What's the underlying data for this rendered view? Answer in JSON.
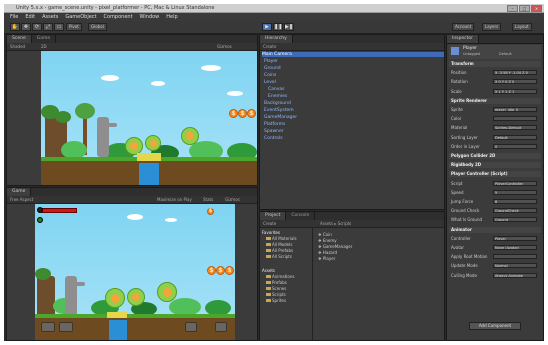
{
  "window": {
    "title": "Unity 5.x.x - game_scene.unity - pixel_platformer - PC, Mac & Linux Standalone",
    "min_icon": "minimize-icon",
    "max_icon": "maximize-icon",
    "close_icon": "close-icon"
  },
  "menu": [
    "File",
    "Edit",
    "Assets",
    "GameObject",
    "Component",
    "Window",
    "Help"
  ],
  "toolbar": {
    "tools": [
      "✋",
      "✥",
      "⟳",
      "⤢",
      "▭"
    ],
    "pivot": "Pivot",
    "global": "Global",
    "play": "▶",
    "pause": "❚❚",
    "step": "▶❚",
    "account": "Account",
    "layers": "Layers",
    "layout": "Layout"
  },
  "scene_panel": {
    "tabs": [
      "Scene",
      "Game"
    ],
    "subbar": [
      "Shaded",
      "2D",
      "Gizmos"
    ]
  },
  "game_panel": {
    "tabs": [
      "Game"
    ],
    "subbar": [
      "Free Aspect",
      "Maximize on Play",
      "Stats",
      "Gizmos"
    ]
  },
  "hierarchy": {
    "tab": "Hierarchy",
    "create": "Create",
    "items": [
      "Main Camera",
      "Player",
      "Ground",
      "Coins",
      "Level",
      "Canvas",
      "Enemies",
      "Background",
      "EventSystem",
      "GameManager",
      "Platforms",
      "Spawner",
      "Controls"
    ]
  },
  "project": {
    "tabs": [
      "Project",
      "Console"
    ],
    "create": "Create",
    "favorites_label": "Favorites",
    "favorites": [
      "All Materials",
      "All Models",
      "All Prefabs",
      "All Scripts"
    ],
    "assets_label": "Assets",
    "assets_folders": [
      "Animations",
      "Prefabs",
      "Scenes",
      "Scripts",
      "Sprites"
    ],
    "right_header": "Assets ▸ Scripts",
    "files": [
      "Coin",
      "Enemy",
      "GameManager",
      "Hazard",
      "Player"
    ]
  },
  "inspector": {
    "tab": "Inspector",
    "object_name": "Player",
    "tag": "Untagged",
    "layer": "Default",
    "rows": [
      {
        "label": "Transform",
        "value": "",
        "header": true
      },
      {
        "label": "Position",
        "value": "X -3.58  Y -1.04  Z 0"
      },
      {
        "label": "Rotation",
        "value": "X 0  Y 0  Z 0"
      },
      {
        "label": "Scale",
        "value": "X 1  Y 1  Z 1"
      },
      {
        "label": "Sprite Renderer",
        "value": "",
        "header": true
      },
      {
        "label": "Sprite",
        "value": "player_idle_0"
      },
      {
        "label": "Color",
        "value": ""
      },
      {
        "label": "Material",
        "value": "Sprites-Default"
      },
      {
        "label": "Sorting Layer",
        "value": "Default"
      },
      {
        "label": "Order in Layer",
        "value": "0"
      },
      {
        "label": "Polygon Collider 2D",
        "value": "",
        "header": true
      },
      {
        "label": "Rigidbody 2D",
        "value": "",
        "header": true
      },
      {
        "label": "Player Controller (Script)",
        "value": "",
        "header": true
      },
      {
        "label": "Script",
        "value": "PlayerController"
      },
      {
        "label": "Speed",
        "value": "5"
      },
      {
        "label": "Jump Force",
        "value": "8"
      },
      {
        "label": "Ground Check",
        "value": "GroundCheck"
      },
      {
        "label": "What Is Ground",
        "value": "Ground"
      },
      {
        "label": "Animator",
        "value": "",
        "header": true
      },
      {
        "label": "Controller",
        "value": "Player"
      },
      {
        "label": "Avatar",
        "value": "None (Avatar)"
      },
      {
        "label": "Apply Root Motion",
        "value": ""
      },
      {
        "label": "Update Mode",
        "value": "Normal"
      },
      {
        "label": "Culling Mode",
        "value": "Always Animate"
      }
    ],
    "add_component": "Add Component"
  },
  "game": {
    "coins_scene": "$$$",
    "coins_game": "$$$"
  },
  "colors": {
    "sky": "#7fd4f2",
    "ground": "#6d4a20",
    "grass": "#4ca62a",
    "coin": "#f28a22",
    "health": "#d01818",
    "selection": "#3d6bb8",
    "hierarchy_text": "#8fb8ff"
  }
}
